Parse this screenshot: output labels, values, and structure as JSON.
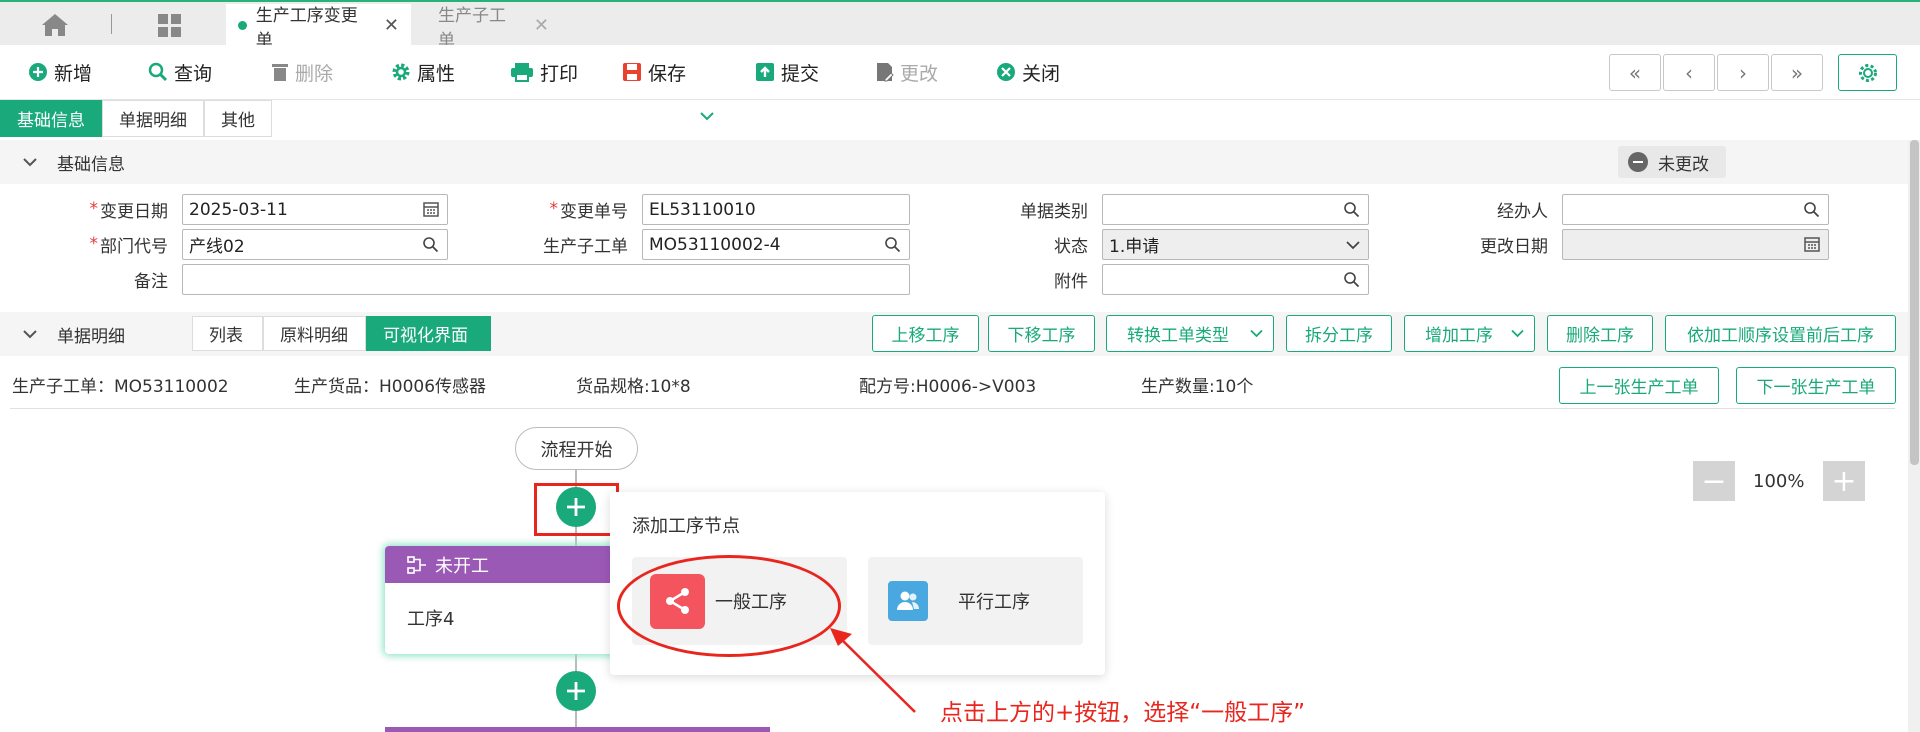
{
  "tabs": [
    {
      "label": "生产工序变更单"
    },
    {
      "label": "生产子工单"
    }
  ],
  "toolbar": {
    "add": "新增",
    "query": "查询",
    "delete": "删除",
    "properties": "属性",
    "print": "打印",
    "save": "保存",
    "submit": "提交",
    "modify": "更改",
    "close": "关闭",
    "nav": [
      "«",
      "‹",
      "›",
      "»"
    ]
  },
  "subtabs": [
    "基础信息",
    "单据明细",
    "其他"
  ],
  "basic": {
    "section_title": "基础信息",
    "status_badge": "未更改",
    "fields": {
      "change_date_label": "变更日期",
      "change_date": "2025-03-11",
      "change_no_label": "变更单号",
      "change_no": "EL53110010",
      "doc_type_label": "单据类别",
      "doc_type": "",
      "handler_label": "经办人",
      "handler": "",
      "dept_label": "部门代号",
      "dept": "产线02",
      "sub_order_label": "生产子工单",
      "sub_order": "MO53110002-4",
      "status_label": "状态",
      "status": "1.申请",
      "modify_date_label": "更改日期",
      "modify_date": "",
      "remark_label": "备注",
      "remark": "",
      "attach_label": "附件",
      "attach": ""
    }
  },
  "detail": {
    "section_title": "单据明细",
    "view_tabs": [
      "列表",
      "原料明细",
      "可视化界面"
    ],
    "buttons": [
      "上移工序",
      "下移工序",
      "转换工单类型",
      "拆分工序",
      "增加工序",
      "删除工序",
      "依加工顺序设置前后工序"
    ],
    "info": {
      "sub_order": "生产子工单：MO53110002",
      "goods": "生产货品：H0006传感器",
      "spec": "货品规格:10*8",
      "recipe": "配方号:H0006->V003",
      "qty": "生产数量:10个"
    },
    "prev_order": "上一张生产工单",
    "next_order": "下一张生产工单"
  },
  "flow": {
    "start": "流程开始",
    "node_status": "未开工",
    "node_name": "工序4",
    "popup_title": "添加工序节点",
    "option_general": "一般工序",
    "option_parallel": "平行工序",
    "zoom": "100%",
    "annotation": "点击上方的+按钮，选择“一般工序”"
  },
  "colors": {
    "accent": "#19a97b",
    "node_header": "#9b59b6",
    "annotation": "#e8261e"
  }
}
